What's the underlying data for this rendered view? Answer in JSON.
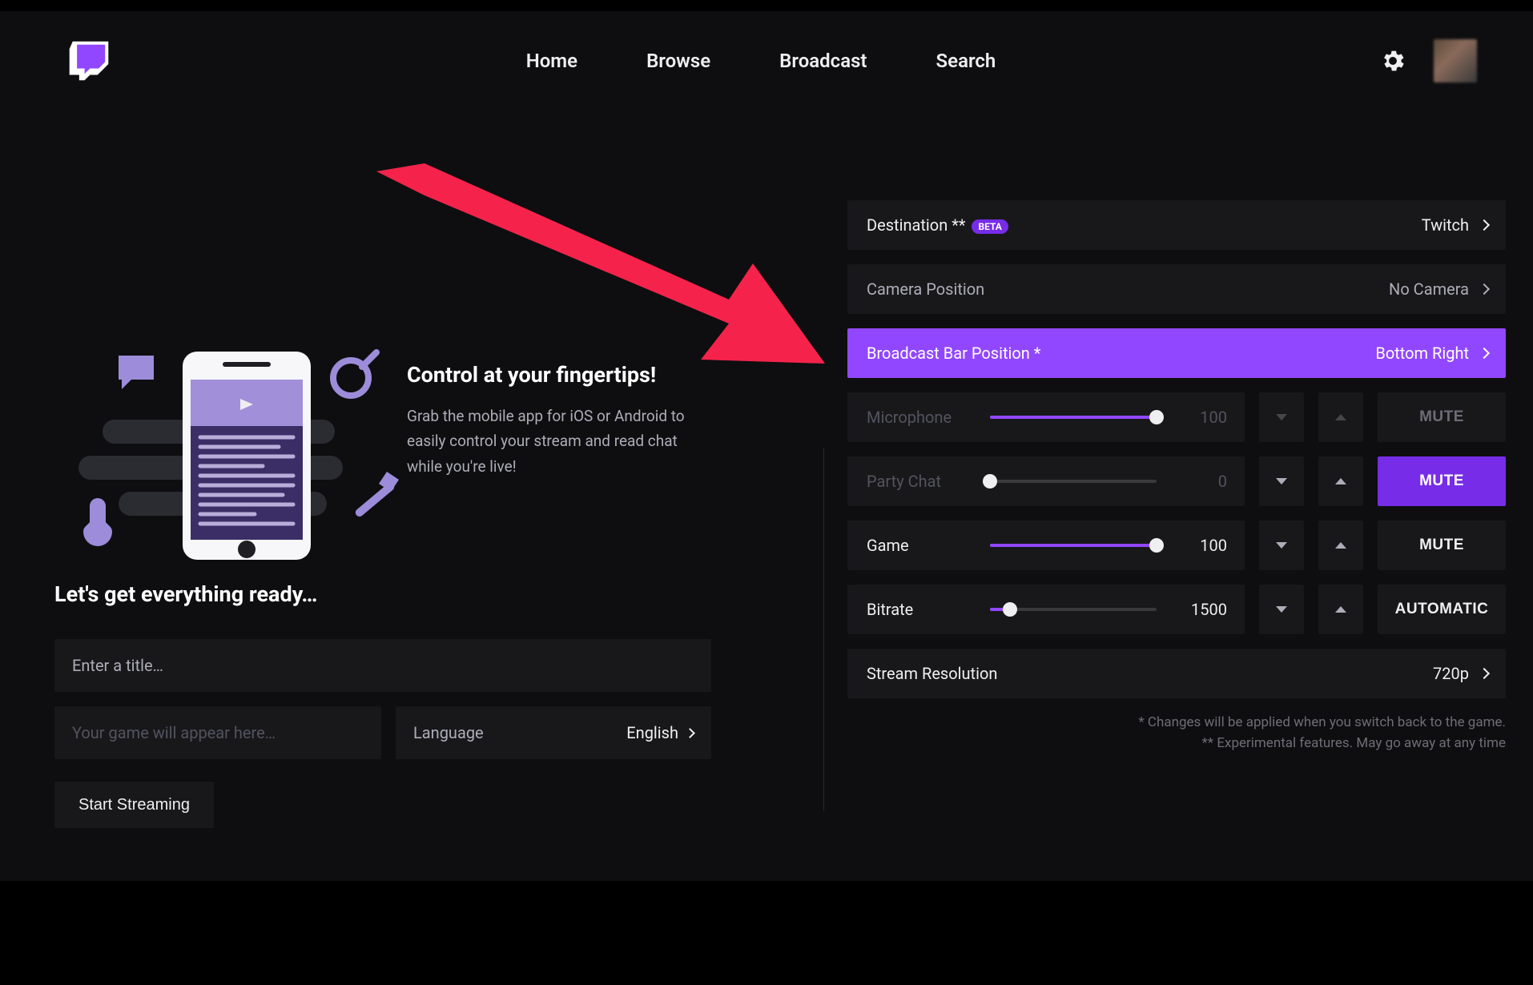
{
  "nav": {
    "home": "Home",
    "browse": "Browse",
    "broadcast": "Broadcast",
    "search": "Search"
  },
  "left": {
    "heading": "Control at your fingertips!",
    "body": "Grab the mobile app for iOS or Android to easily control your stream and read chat while you're live!",
    "ready": "Let's get everything ready…",
    "title_ph": "Enter a title…",
    "game_ph": "Your game will appear here…",
    "lang_label": "Language",
    "lang_value": "English",
    "start": "Start Streaming"
  },
  "right": {
    "dest_label": "Destination **",
    "dest_beta": "BETA",
    "dest_value": "Twitch",
    "cam_label": "Camera Position",
    "cam_value": "No Camera",
    "bar_label": "Broadcast Bar Position *",
    "bar_value": "Bottom Right",
    "mic_label": "Microphone",
    "mic_value": "100",
    "mic_pct": 100,
    "party_label": "Party Chat",
    "party_value": "0",
    "party_pct": 0,
    "game_label": "Game",
    "game_value": "100",
    "game_pct": 100,
    "bitrate_label": "Bitrate",
    "bitrate_value": "1500",
    "bitrate_pct": 12,
    "mute": "MUTE",
    "automatic": "AUTOMATIC",
    "res_label": "Stream Resolution",
    "res_value": "720p",
    "foot1": "* Changes will be applied when you switch back to the game.",
    "foot2": "** Experimental features. May go away at any time"
  }
}
